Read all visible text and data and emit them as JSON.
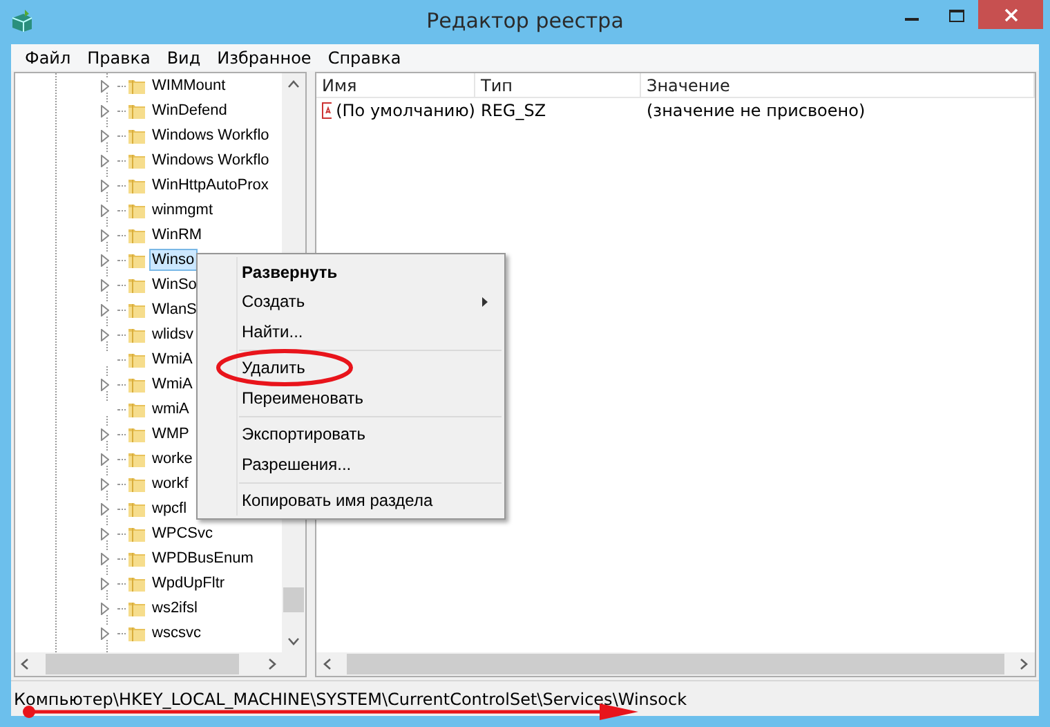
{
  "window": {
    "title": "Редактор реестра"
  },
  "menu_bar": [
    "Файл",
    "Правка",
    "Вид",
    "Избранное",
    "Справка"
  ],
  "tree": {
    "items": [
      {
        "label": "WIMMount",
        "expandable": true,
        "selected": false
      },
      {
        "label": "WinDefend",
        "expandable": true,
        "selected": false
      },
      {
        "label": "Windows Workflo",
        "expandable": true,
        "selected": false
      },
      {
        "label": "Windows Workflo",
        "expandable": true,
        "selected": false
      },
      {
        "label": "WinHttpAutoProx",
        "expandable": true,
        "selected": false
      },
      {
        "label": "winmgmt",
        "expandable": true,
        "selected": false
      },
      {
        "label": "WinRM",
        "expandable": true,
        "selected": false
      },
      {
        "label": "Winso",
        "expandable": true,
        "selected": true
      },
      {
        "label": "WinSo",
        "expandable": true,
        "selected": false
      },
      {
        "label": "WlanS",
        "expandable": true,
        "selected": false
      },
      {
        "label": "wlidsv",
        "expandable": true,
        "selected": false
      },
      {
        "label": "WmiA",
        "expandable": false,
        "selected": false
      },
      {
        "label": "WmiA",
        "expandable": true,
        "selected": false
      },
      {
        "label": "wmiA",
        "expandable": false,
        "selected": false
      },
      {
        "label": "WMP",
        "expandable": true,
        "selected": false
      },
      {
        "label": "worke",
        "expandable": true,
        "selected": false
      },
      {
        "label": "workf",
        "expandable": true,
        "selected": false
      },
      {
        "label": "wpcfl",
        "expandable": true,
        "selected": false
      },
      {
        "label": "WPCSvc",
        "expandable": true,
        "selected": false
      },
      {
        "label": "WPDBusEnum",
        "expandable": true,
        "selected": false
      },
      {
        "label": "WpdUpFltr",
        "expandable": true,
        "selected": false
      },
      {
        "label": "ws2ifsl",
        "expandable": true,
        "selected": false
      },
      {
        "label": "wscsvc",
        "expandable": true,
        "selected": false
      }
    ]
  },
  "values": {
    "columns": [
      "Имя",
      "Тип",
      "Значение"
    ],
    "rows": [
      {
        "name": "(По умолчанию)",
        "type": "REG_SZ",
        "data": "(значение не присвоено)"
      }
    ]
  },
  "context_menu": [
    {
      "kind": "item",
      "label": "Развернуть",
      "default": true,
      "submenu": false,
      "circled": false
    },
    {
      "kind": "item",
      "label": "Создать",
      "default": false,
      "submenu": true,
      "circled": false
    },
    {
      "kind": "item",
      "label": "Найти...",
      "default": false,
      "submenu": false,
      "circled": false
    },
    {
      "kind": "separator"
    },
    {
      "kind": "item",
      "label": "Удалить",
      "default": false,
      "submenu": false,
      "circled": true
    },
    {
      "kind": "item",
      "label": "Переименовать",
      "default": false,
      "submenu": false,
      "circled": false
    },
    {
      "kind": "separator"
    },
    {
      "kind": "item",
      "label": "Экспортировать",
      "default": false,
      "submenu": false,
      "circled": false
    },
    {
      "kind": "item",
      "label": "Разрешения...",
      "default": false,
      "submenu": false,
      "circled": false
    },
    {
      "kind": "separator"
    },
    {
      "kind": "item",
      "label": "Копировать имя раздела",
      "default": false,
      "submenu": false,
      "circled": false
    }
  ],
  "status_bar": "Компьютер\\HKEY_LOCAL_MACHINE\\SYSTEM\\CurrentControlSet\\Services\\Winsock"
}
